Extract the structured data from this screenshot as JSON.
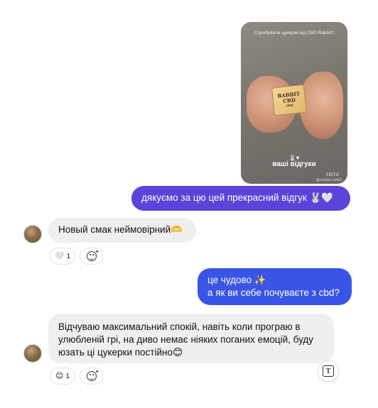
{
  "story": {
    "caption_top": "Спробували цукерки від CBD Rabbit?",
    "candy_text_1": "RABBIT",
    "candy_text_2": "CBD",
    "candy_sub": "cbd",
    "rabbit_emoji": "🐰♥",
    "reviews_label": "ваші відгуки",
    "counter": "10/10",
    "handle": "@ralisa.rabit"
  },
  "messages": [
    {
      "sender": "me",
      "text": "дякуємо за цю цей прекрасний відгук 🐰🤍"
    },
    {
      "sender": "them",
      "text": "Новый смак неймовірний🫶"
    },
    {
      "sender": "me",
      "lines": [
        "це чудово ✨",
        "а як ви себе почуваєте з cbd?"
      ]
    },
    {
      "sender": "them",
      "text": "Відчуваю максимальний спокій, навіть коли програю в улюбленій грі, на диво немає ніяких поганих емоцій, буду юзать ці цукерки постійно😊"
    }
  ],
  "reactions": [
    {
      "emoji": "🤍",
      "count": "1"
    },
    {
      "emoji": "😊",
      "count": "1"
    }
  ],
  "icons": {
    "add_reaction": "add-reaction-icon",
    "translate": "translate-icon"
  },
  "colors": {
    "outgoing_bubble_1": "#5a44d9",
    "outgoing_bubble_2": "#3a55e6",
    "incoming_bubble": "#efefef"
  }
}
